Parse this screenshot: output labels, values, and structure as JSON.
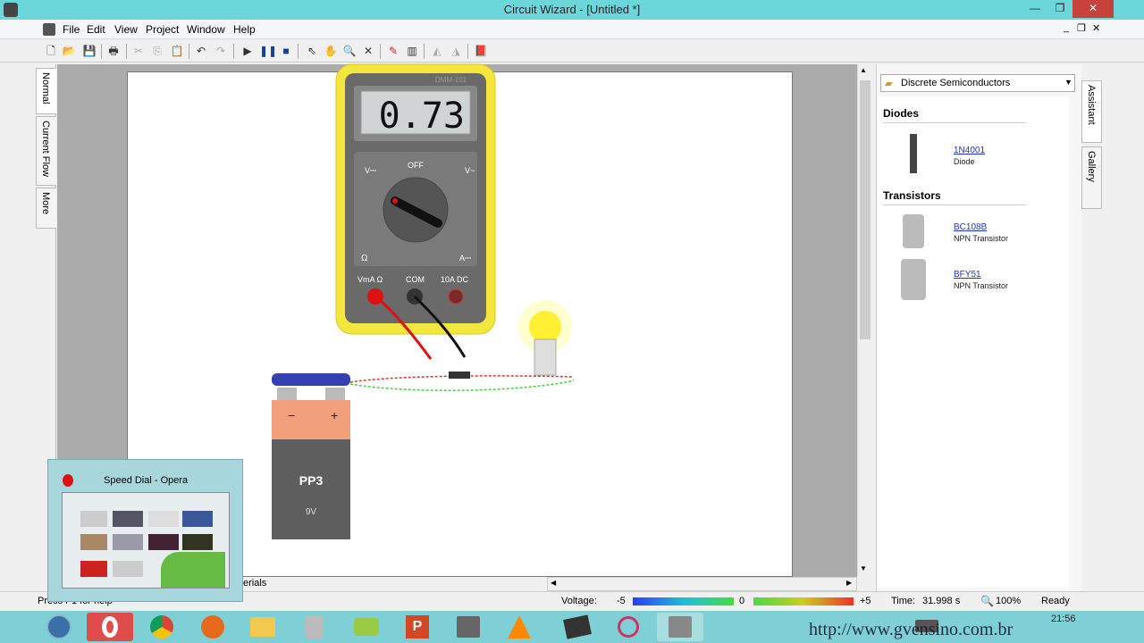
{
  "window": {
    "title": "Circuit Wizard - [Untitled *]"
  },
  "menu": [
    "File",
    "Edit",
    "View",
    "Project",
    "Window",
    "Help"
  ],
  "left_tabs": [
    "Normal",
    "Current Flow",
    "More"
  ],
  "multimeter": {
    "display": "0.73",
    "model": "DMM-101",
    "off_label": "OFF",
    "range_labels": {
      "v_dc": "V⎓",
      "v_ac": "V~",
      "ohm": "Ω",
      "a_dc": "A⎓"
    },
    "sockets": [
      "VmA Ω",
      "COM",
      "10A DC"
    ]
  },
  "battery": {
    "label": "PP3",
    "voltage": "9V",
    "neg": "−",
    "pos": "+"
  },
  "sheet_tab": "erials",
  "gallery": {
    "category": "Discrete Semiconductors",
    "sections": [
      {
        "title": "Diodes",
        "items": [
          {
            "name": "1N4001",
            "desc": "Diode"
          }
        ]
      },
      {
        "title": "Transistors",
        "items": [
          {
            "name": "BC108B",
            "desc": "NPN Transistor"
          },
          {
            "name": "BFY51",
            "desc": "NPN Transistor"
          }
        ]
      }
    ]
  },
  "right_tabs": [
    "Assistant",
    "Gallery"
  ],
  "status": {
    "help": "Press F1 for help",
    "voltage_label": "Voltage:",
    "v_min": "-5",
    "v_mid": "0",
    "v_max": "+5",
    "time_label": "Time:",
    "time_value": "31.998 s",
    "zoom": "100%",
    "state": "Ready"
  },
  "opera_preview": {
    "title": "Speed Dial - Opera"
  },
  "taskbar": {
    "clock": "21:56",
    "watermark": "http://www.gvensino.com.br"
  }
}
